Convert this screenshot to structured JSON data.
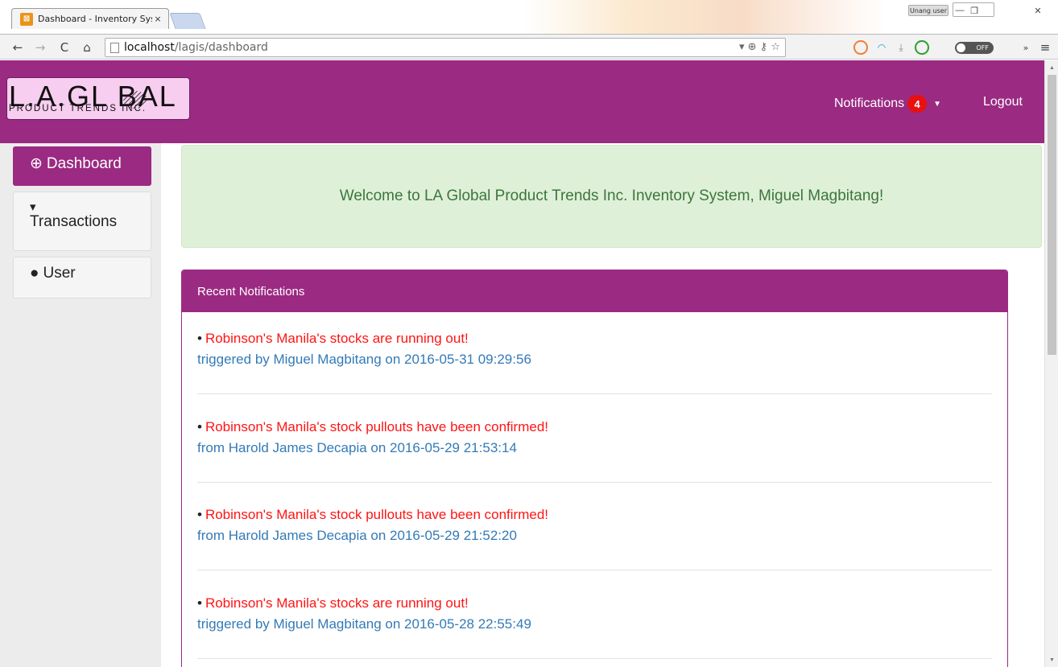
{
  "browser": {
    "tab_title": "Dashboard - Inventory Sys",
    "tab_close": "×",
    "favicon_glyph": "⊠",
    "user_badge": "Unang user",
    "url_host": "localhost",
    "url_path": "/lagis/dashboard",
    "window_controls": [
      "—",
      "❐",
      "✕"
    ]
  },
  "brand": {
    "logo_big": "L.A.GL  BAL",
    "logo_sub": "PRODUCT TRENDS INC."
  },
  "nav": {
    "notifications_label": "Notifications",
    "notifications_count": "4",
    "logout_label": "Logout"
  },
  "sidebar": {
    "items": [
      {
        "label": "Dashboard",
        "icon": "dashboard-icon",
        "active": true
      },
      {
        "label": "Transactions",
        "icon": "cart-icon",
        "active": false
      },
      {
        "label": "User",
        "icon": "user-icon",
        "active": false
      }
    ]
  },
  "welcome": {
    "message": "Welcome to LA Global Product Trends Inc. Inventory System, Miguel Magbitang!"
  },
  "notifications_panel": {
    "title": "Recent Notifications",
    "items": [
      {
        "message": "Robinson's Manila's stocks are running out!",
        "meta": "triggered by Miguel Magbitang on 2016-05-31 09:29:56"
      },
      {
        "message": "Robinson's Manila's stock pullouts have been confirmed!",
        "meta": "from Harold James Decapia on 2016-05-29 21:53:14"
      },
      {
        "message": "Robinson's Manila's stock pullouts have been confirmed!",
        "meta": "from Harold James Decapia on 2016-05-29 21:52:20"
      },
      {
        "message": "Robinson's Manila's stocks are running out!",
        "meta": "triggered by Miguel Magbitang on 2016-05-28 22:55:49"
      }
    ]
  },
  "colors": {
    "brand_purple": "#9b2a82",
    "alert_red": "#ff1414",
    "link_blue": "#337ab7",
    "success_bg": "#dff0d8",
    "success_text": "#3c763d",
    "badge_red": "#e81010"
  }
}
